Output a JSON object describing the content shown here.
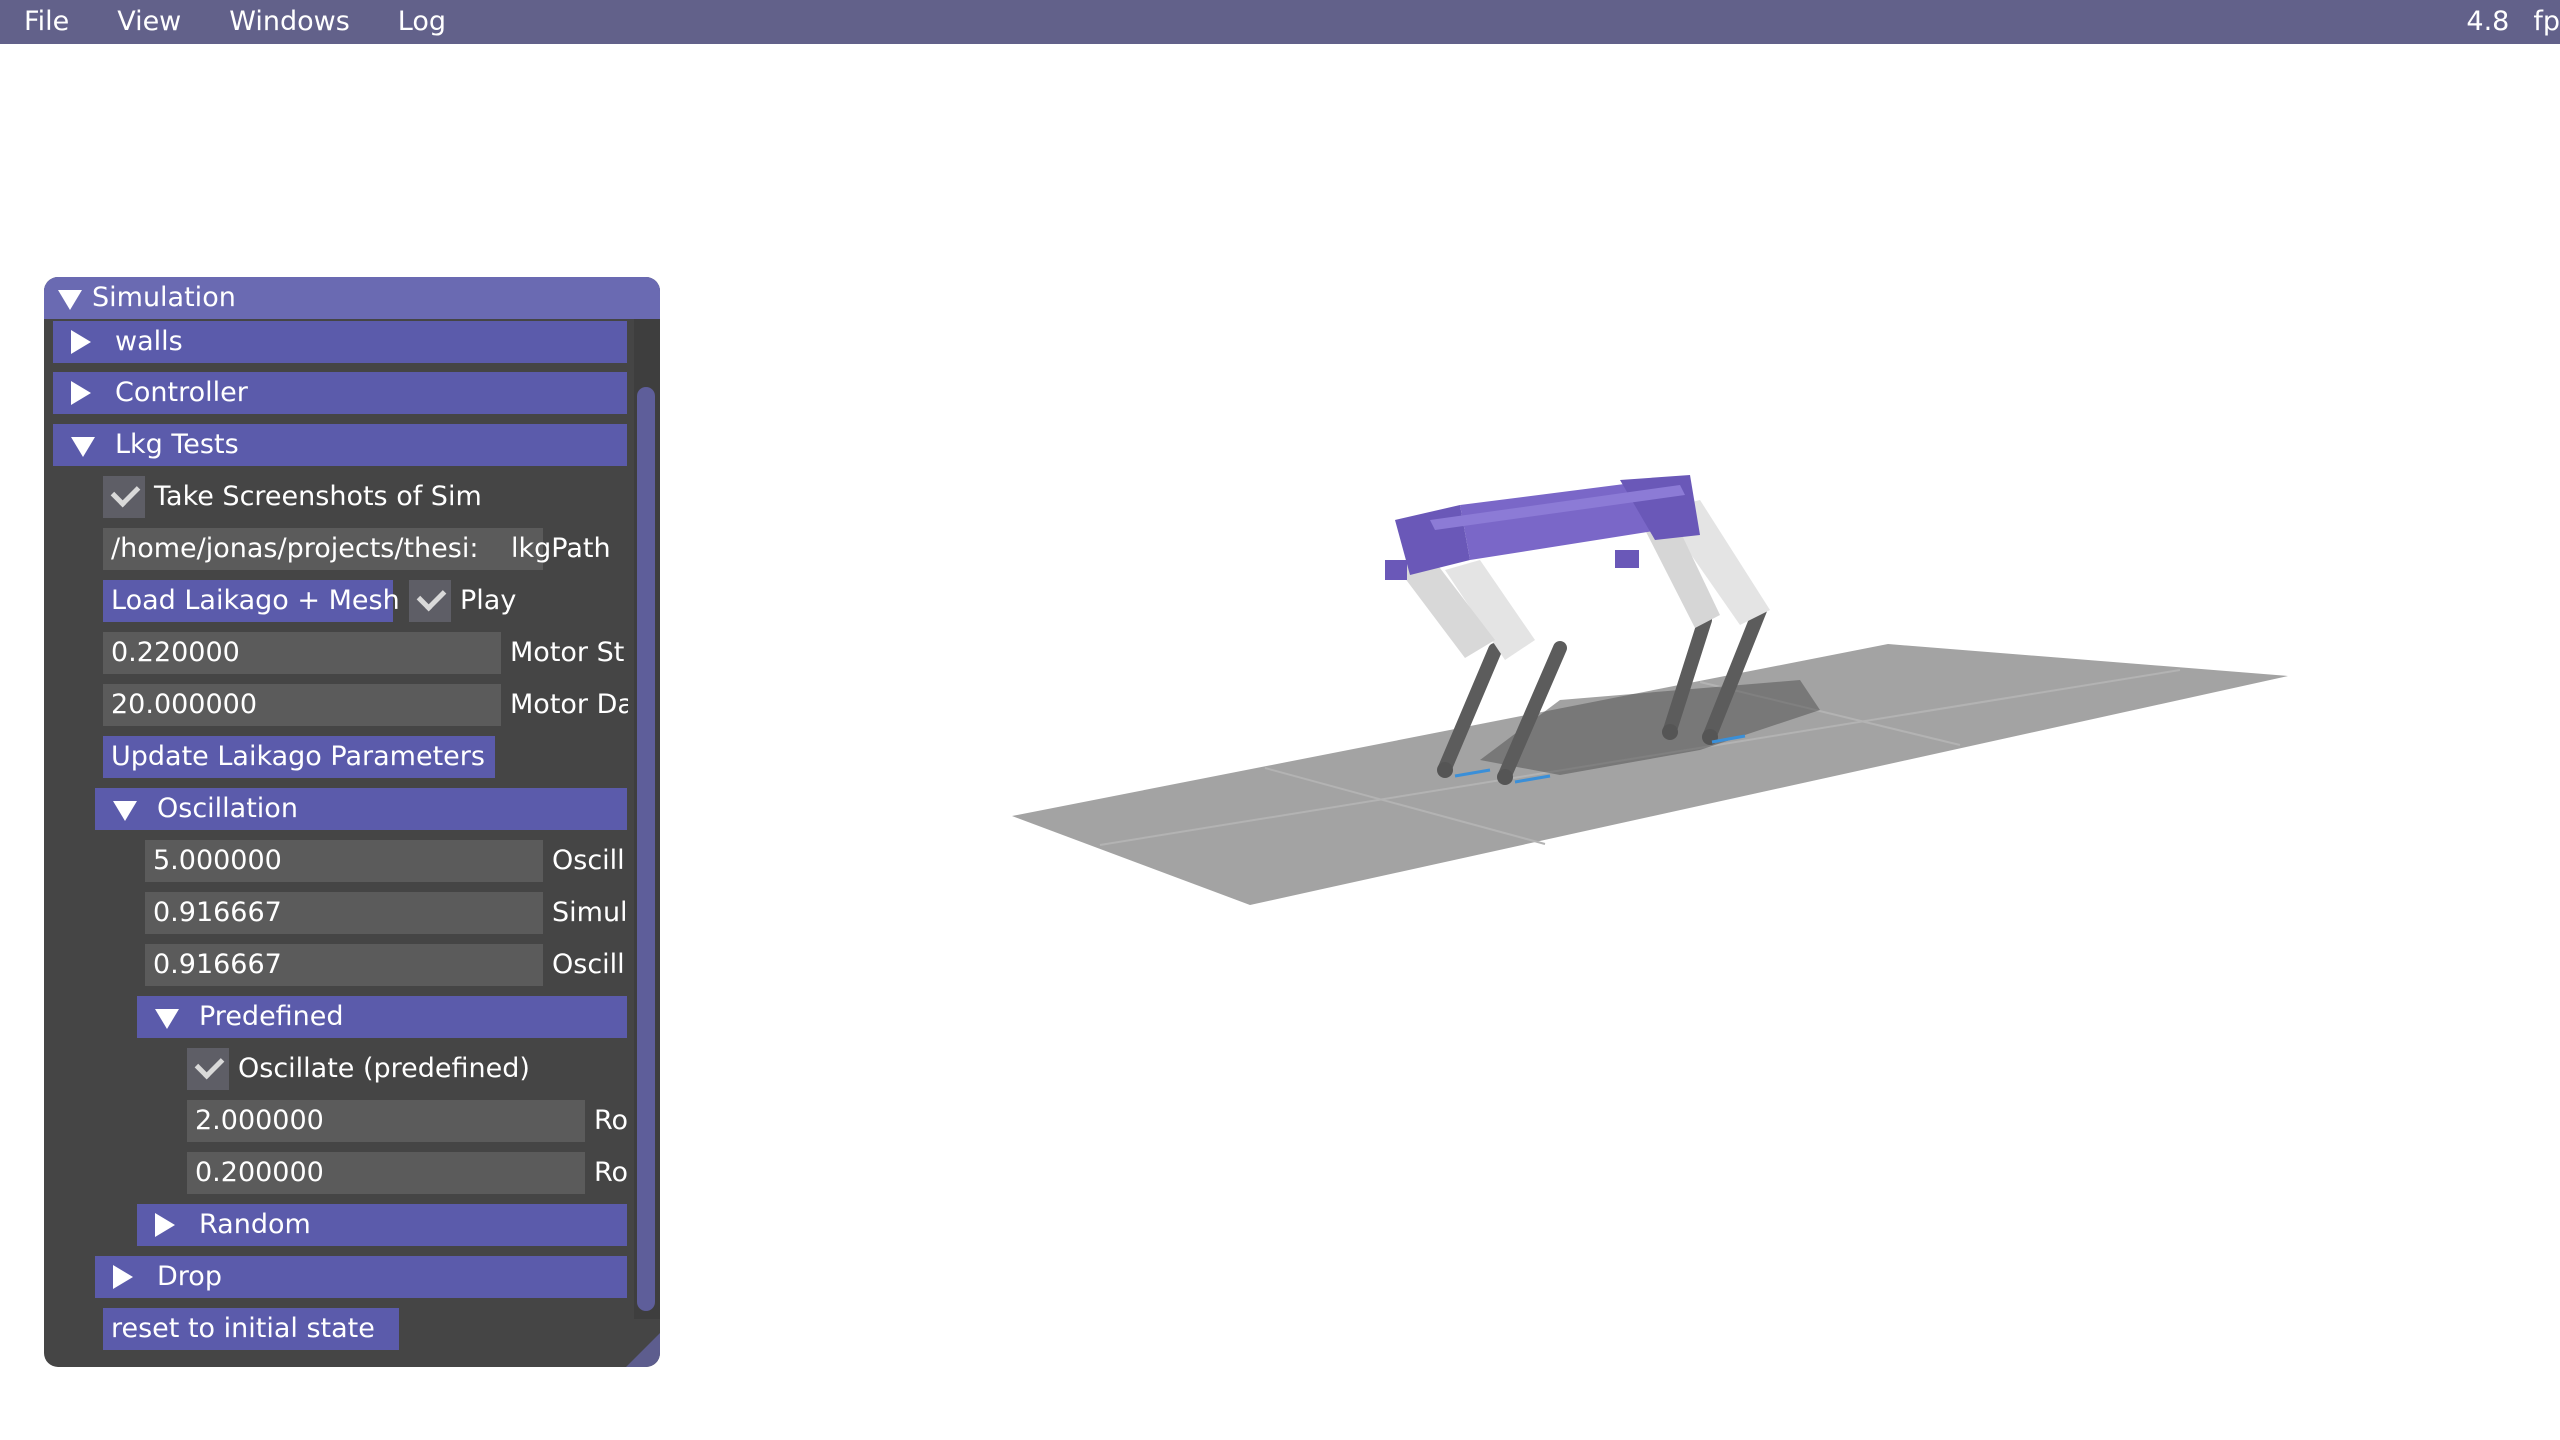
{
  "menubar": {
    "items": [
      "File",
      "View",
      "Windows",
      "Log"
    ],
    "fps_value": "4.8",
    "fps_unit": "fp"
  },
  "window": {
    "title": "Simulation",
    "sections": {
      "walls": "walls",
      "controller": "Controller",
      "lkg_tests": "Lkg Tests",
      "oscillation": "Oscillation",
      "predefined": "Predefined",
      "random": "Random",
      "drop": "Drop"
    },
    "take_screenshots": {
      "label": "Take Screenshots of Sim",
      "checked": true
    },
    "lkg_path": {
      "value": "/home/jonas/projects/thesi:",
      "label": "lkgPath"
    },
    "load_button": "Load Laikago + Mesh",
    "play": {
      "label": "Play",
      "checked": true
    },
    "motor_stiffness": {
      "value": "0.220000",
      "label": "Motor St"
    },
    "motor_damping": {
      "value": "20.000000",
      "label": "Motor Da"
    },
    "update_button": "Update Laikago Parameters",
    "oscillation_fields": [
      {
        "value": "5.000000",
        "label": "Oscill"
      },
      {
        "value": "0.916667",
        "label": "Simul"
      },
      {
        "value": "0.916667",
        "label": "Oscill"
      }
    ],
    "oscillate_predefined": {
      "label": "Oscillate (predefined)",
      "checked": true
    },
    "predefined_fields": [
      {
        "value": "2.000000",
        "label": "Ro"
      },
      {
        "value": "0.200000",
        "label": "Ro"
      }
    ],
    "reset_button": "reset to initial state"
  },
  "colors": {
    "menubar": "#62618a",
    "header": "#5b5bab",
    "window_bg": "#454545",
    "robot": "#7a67c8",
    "ground": "#a3a3a3"
  }
}
